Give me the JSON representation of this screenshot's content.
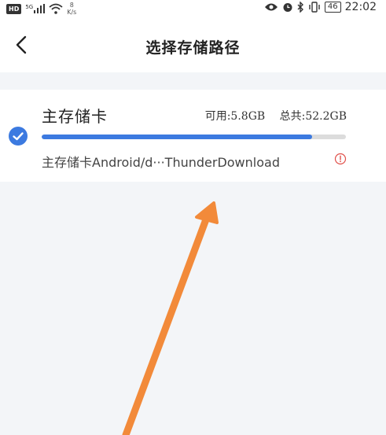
{
  "status_bar": {
    "hd": "HD",
    "signal_type": "5G",
    "speed_value": "8",
    "speed_unit": "K/s",
    "battery": "46",
    "time": "22:02"
  },
  "header": {
    "title": "选择存储路径"
  },
  "storage": {
    "name": "主存储卡",
    "available": "可用:5.8GB",
    "total": "总共:52.2GB",
    "used_fraction": 0.89,
    "path": "主存储卡Android/d···ThunderDownload",
    "selected": true
  },
  "colors": {
    "accent": "#3c7ae0",
    "annotation_arrow": "#f28a3a",
    "warning": "#e0504a"
  }
}
